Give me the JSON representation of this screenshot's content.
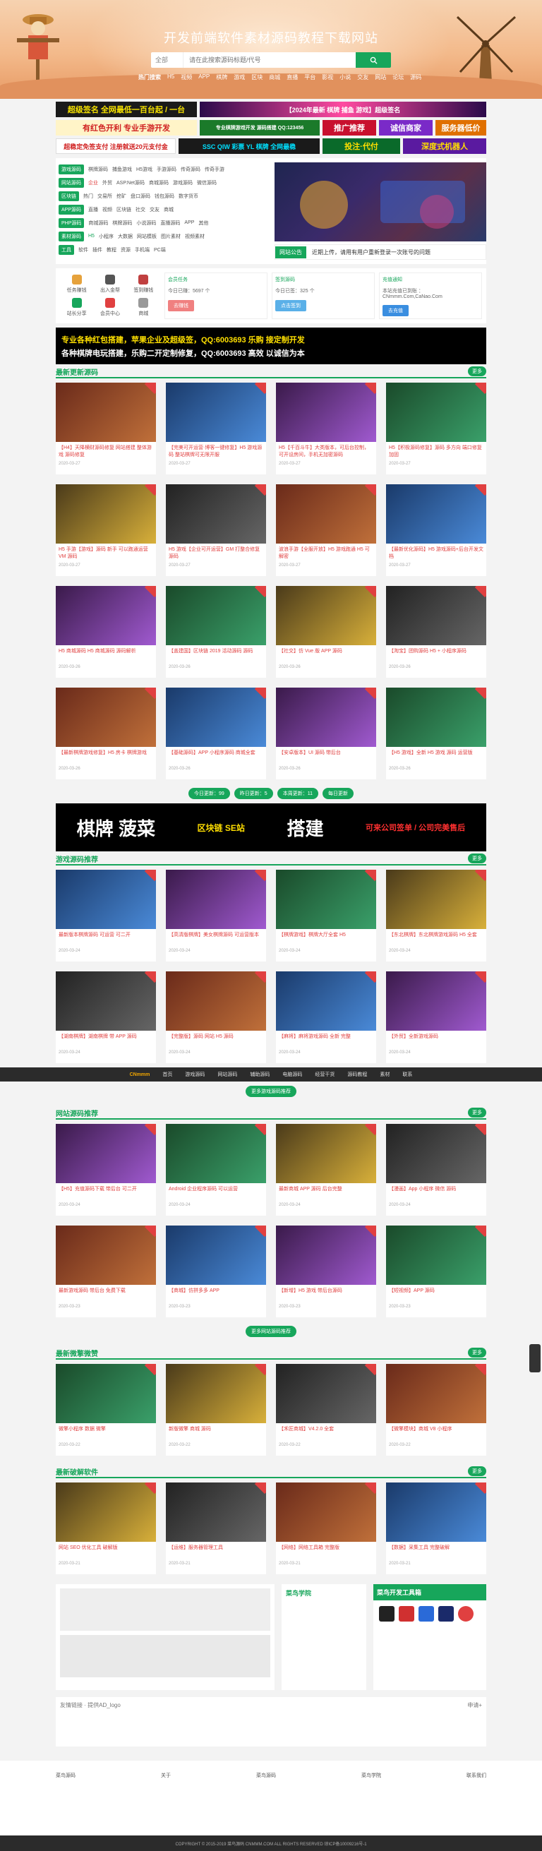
{
  "header": {
    "title": "开发前端软件素材源码教程下载网站",
    "search_select": "全部",
    "search_placeholder": "请在此搜索源码标题/代号",
    "hot_words": [
      "热门搜索",
      "H5",
      "视频",
      "APP",
      "棋牌",
      "游戏",
      "区块",
      "商城",
      "直播",
      "平台",
      "影视",
      "小说",
      "交友",
      "网站",
      "论坛",
      "源码"
    ]
  },
  "ads": {
    "row1": [
      "超级签名 全网最低一百台起 / 一台",
      "【2024年最新 棋牌 捕鱼 游戏】超级签名"
    ],
    "row2": [
      "有红色开利 专业手游开发",
      "专业棋牌游戏开发 源码搭建 QQ:123456",
      "推广推荐",
      "诚信商家",
      "服务器低价"
    ],
    "row3": [
      "超稳定免签支付 注册就送20元支付金",
      "SSC QIW 彩票 YL 棋牌 全网最稳",
      "投注·代付",
      "深度式机器人"
    ]
  },
  "categories": [
    {
      "tag": "游戏源码",
      "items": [
        "棋牌源码",
        "捕鱼游戏",
        "H5游戏",
        "手游源码",
        "传奇源码",
        "传奇手游"
      ]
    },
    {
      "tag": "网站源码",
      "items": [
        "企业",
        "外贸",
        "ASP.Net源码",
        "商城源码",
        "游戏源码",
        "微信源码"
      ]
    },
    {
      "tag": "区块链",
      "items": [
        "热门",
        "交易所",
        "挖矿",
        "盘口源码",
        "钱包源码",
        "数字货币"
      ]
    },
    {
      "tag": "APP源码",
      "items": [
        "直播",
        "视频",
        "区块链",
        "社交",
        "交友",
        "商城"
      ]
    },
    {
      "tag": "PHP源码",
      "items": [
        "商城源码",
        "棋牌源码",
        "小说源码",
        "直播源码",
        "APP",
        "其他"
      ]
    },
    {
      "tag": "素材源码",
      "items": [
        "H5",
        "小程序",
        "大数据",
        "网站模板",
        "图片素材",
        "视频素材"
      ]
    },
    {
      "tag": "工具",
      "items": [
        "软件",
        "插件",
        "教程",
        "资源",
        "手机端",
        "PC端"
      ]
    }
  ],
  "notice": {
    "label": "网站公告",
    "text": "近期上传，请用有用户重新登录一次账号的问题"
  },
  "quick": {
    "icons": [
      "任务赚钱",
      "出入金帮",
      "签到赚钱",
      "站长分享",
      "会员中心",
      "商城"
    ],
    "cards": [
      {
        "title": "会员任务",
        "sub": "今日已赚：5697 个",
        "btn": "去赚钱"
      },
      {
        "title": "签到源码",
        "sub": "今日已签：325 个",
        "btn": "点击签到"
      },
      {
        "title": "充值通知",
        "sub": "本站充值已到账 ： CNmmm.Com,CaNao.Com",
        "btn": "去充值"
      }
    ]
  },
  "mid_ad": {
    "left": "专业各种红包搭建，苹果企业及超级签，QQ:6003693 乐购 接定制开发",
    "right": "各种棋牌电玩搭建，乐购二开定制修复，QQ:6003693 高效 以诚信为本"
  },
  "sections": [
    {
      "title": "最新更新源码",
      "more": "更多",
      "cards": [
        [
          "【H4】天降横财源码修复 网站搭建 整体游戏 源码修复",
          "2020-03-27"
        ],
        [
          "【完美可开运营·博客一键修复】H5 游戏源码 整站棋牌可无限开服",
          "2020-03-27"
        ],
        [
          "H5【千百斗牛】大类版本，可后台控制，可开设房间，手机无加密源码",
          "2020-03-27"
        ],
        [
          "H5【积极源码修复】源码 多方向 端口修复加固",
          "2020-03-27"
        ],
        [
          "H5 手游【游戏】源码 新手 可以跑通运营 VM 源码",
          "2020-03-27"
        ],
        [
          "H5 游戏【企业可开运营】GM 打整合修复源码",
          "2020-03-27"
        ],
        [
          "波浪手游【全服开放】H5 游戏跑通 H5 可解密",
          "2020-03-27"
        ],
        [
          "【最新优化源码】H5 游戏源码+后台开发文档",
          "2020-03-27"
        ],
        [
          "H5 商城源码 H5 商城源码 源码解析",
          "2020-03-26"
        ],
        [
          "【盖建国】区块链 2019 活动源码 源码",
          "2020-03-26"
        ],
        [
          "【社交】仿 Vue 版 APP 源码",
          "2020-03-26"
        ],
        [
          "【淘宝】团购源码 H5 + 小程序源码",
          "2020-03-26"
        ],
        [
          "【最新棋牌游戏修复】H5 房卡 棋牌游戏",
          "2020-03-26"
        ],
        [
          "【基础源码】APP 小程序源码 商城全套",
          "2020-03-26"
        ],
        [
          "【安卓版本】UI 源码 带后台",
          "2020-03-26"
        ],
        [
          "【H5 游戏】全新 H5 游戏 源码 运营版",
          "2020-03-26"
        ]
      ]
    },
    {
      "title": "游戏源码推荐",
      "more": "更多",
      "cards": [
        [
          "最新版本棋牌源码 可运营 可二开",
          "2020-03-24"
        ],
        [
          "【高清版棋牌】美女棋牌源码 可运营版本",
          "2020-03-24"
        ],
        [
          "【棋牌游戏】棋牌大厅全套 H5",
          "2020-03-24"
        ],
        [
          "【东北棋牌】东北棋牌游戏源码 H5 全套",
          "2020-03-24"
        ],
        [
          "【湖南棋牌】湖南棋牌 带 APP 源码",
          "2020-03-24"
        ],
        [
          "【完整版】源码 网站 H5 源码",
          "2020-03-24"
        ],
        [
          "【麻将】麻将游戏源码 全新 完整",
          "2020-03-24"
        ],
        [
          "【外贸】全新游戏源码",
          "2020-03-24"
        ]
      ]
    },
    {
      "title": "网站源码推荐",
      "more": "更多",
      "cards": [
        [
          "【H5】充值源码下载 带后台 可二开",
          "2020-03-24"
        ],
        [
          "Android 企业程序源码 可以运营",
          "2020-03-24"
        ],
        [
          "最新商城 APP 源码 后台完整",
          "2020-03-24"
        ],
        [
          "【漫画】App 小程序 微信 源码",
          "2020-03-24"
        ],
        [
          "最新游戏源码 带后台 免费下载",
          "2020-03-23"
        ],
        [
          "【商城】仿拼多多 APP",
          "2020-03-23"
        ],
        [
          "【新增】H5 游戏 带后台源码",
          "2020-03-23"
        ],
        [
          "【短视频】APP 源码",
          "2020-03-23"
        ]
      ]
    },
    {
      "title": "最新微擎微赞",
      "more": "更多",
      "cards": [
        [
          "微擎小程序 数据 微擎",
          "2020-03-22"
        ],
        [
          "新版微擎 商城 源码",
          "2020-03-22"
        ],
        [
          "【禾匠商城】V4.2.0 全套",
          "2020-03-22"
        ],
        [
          "【微擎模块】商城 V8 小程序",
          "2020-03-22"
        ]
      ]
    },
    {
      "title": "最新破解软件",
      "more": "更多",
      "cards": [
        [
          "网站 SEO 优化工具 破解版",
          "2020-03-21"
        ],
        [
          "【运维】服务器管理工具",
          "2020-03-21"
        ],
        [
          "【网络】网络工具箱 完整版",
          "2020-03-21"
        ],
        [
          "【数据】采集工具 完整破解",
          "2020-03-21"
        ]
      ]
    }
  ],
  "nav2": {
    "logo": "CNmmm",
    "items": [
      "首页",
      "游戏源码",
      "网站源码",
      "辅助源码",
      "电脑源码",
      "经营干货",
      "源码教程",
      "素材",
      "联系"
    ]
  },
  "greenbtns": [
    "今日更新：99",
    "昨日更新：5",
    "本周更新：11",
    "每日更新"
  ],
  "morebtn": "更多网站源码推荐",
  "morebtn2": "更多游戏源码推荐",
  "bottom": {
    "school_title": "菜鸟学院",
    "toolbox_title": "菜鸟开发工具箱",
    "friend_title": "友情链接 · 提供AD_logo",
    "friend_more": "申请+"
  },
  "footer": {
    "cols": [
      "菜鸟源码",
      "关于",
      "菜鸟源码",
      "菜鸟学院",
      "联系我们"
    ],
    "copyright": "COPYRIGHT © 2015-2019 菜鸟源码 CNMMM.COM ALL RIGHTS RESERVED 琼ICP备10009216号-1"
  }
}
